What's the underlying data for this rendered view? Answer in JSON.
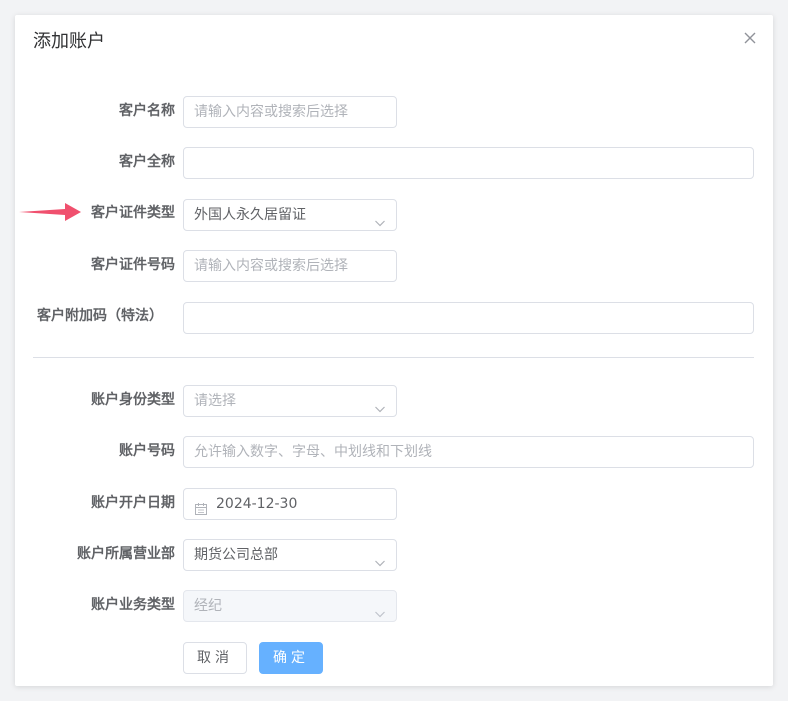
{
  "dialog": {
    "title": "添加账户",
    "close_icon": "close-icon"
  },
  "fields": {
    "customer_name": {
      "label": "客户名称",
      "placeholder": "请输入内容或搜索后选择",
      "value": ""
    },
    "customer_full_name": {
      "label": "客户全称",
      "value": ""
    },
    "customer_id_type": {
      "label": "客户证件类型",
      "value": "外国人永久居留证"
    },
    "customer_id_number": {
      "label": "客户证件号码",
      "placeholder": "请输入内容或搜索后选择",
      "value": ""
    },
    "customer_extra_code": {
      "label": "客户附加码（特法）",
      "value": ""
    },
    "account_identity_type": {
      "label": "账户身份类型",
      "placeholder": "请选择",
      "value": ""
    },
    "account_number": {
      "label": "账户号码",
      "placeholder": "允许输入数字、字母、中划线和下划线",
      "value": ""
    },
    "account_open_date": {
      "label": "账户开户日期",
      "value": "2024-12-30"
    },
    "account_branch": {
      "label": "账户所属营业部",
      "value": "期货公司总部"
    },
    "account_business_type": {
      "label": "账户业务类型",
      "value": "经纪"
    }
  },
  "buttons": {
    "cancel": "取消",
    "ok": "确定"
  },
  "colors": {
    "primary": "#66b1ff",
    "arrow": "#f0506e",
    "border": "#dcdfe6"
  }
}
